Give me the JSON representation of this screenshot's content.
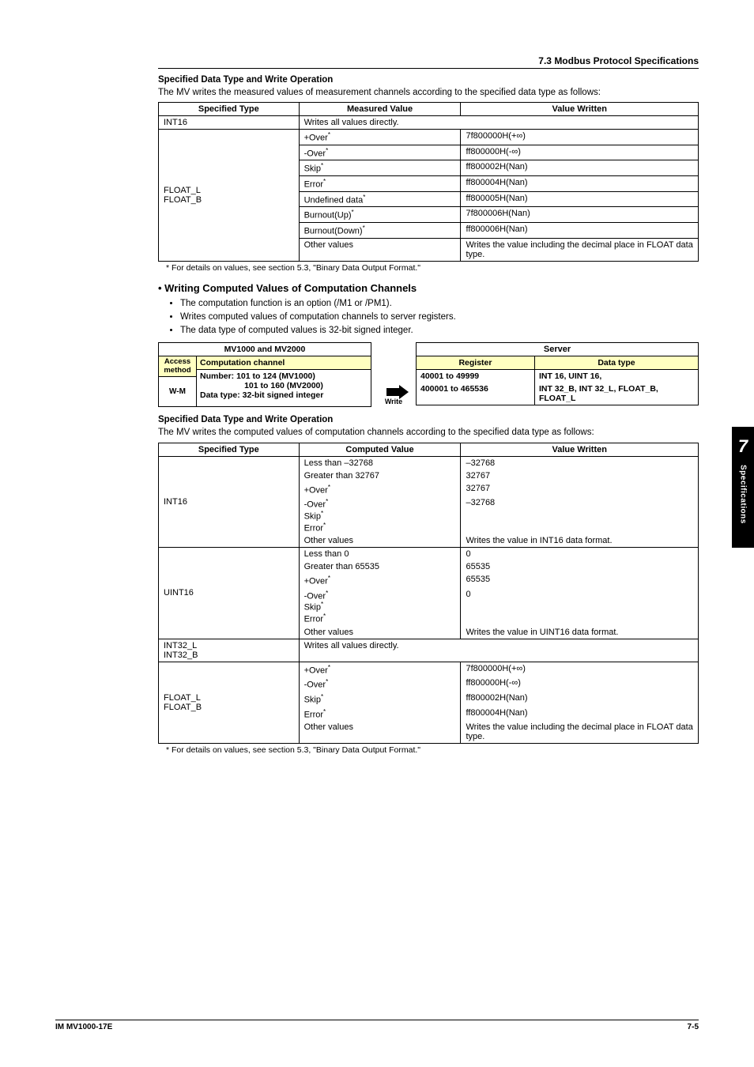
{
  "header": {
    "section": "7.3  Modbus Protocol Specifications"
  },
  "block1": {
    "heading": "Specified Data Type and Write Operation",
    "intro": "The MV writes the measured values of measurement channels according to the specified data type as follows:",
    "table": {
      "headers": [
        "Specified Type",
        "Measured Value",
        "Value Written"
      ],
      "row_int16": {
        "type": "INT16",
        "span": "Writes all values directly."
      },
      "group_label": "FLOAT_L\nFLOAT_B",
      "rows": [
        {
          "mv": "+Over",
          "sup": "*",
          "vw": "7f800000H(+∞)"
        },
        {
          "mv": "-Over",
          "sup": "*",
          "vw": "ff800000H(-∞)"
        },
        {
          "mv": "Skip",
          "sup": "*",
          "vw": "ff800002H(Nan)"
        },
        {
          "mv": "Error",
          "sup": "*",
          "vw": "ff800004H(Nan)"
        },
        {
          "mv": "Undefined data",
          "sup": "*",
          "vw": "ff800005H(Nan)"
        },
        {
          "mv": "Burnout(Up)",
          "sup": "*",
          "vw": "7f800006H(Nan)"
        },
        {
          "mv": "Burnout(Down)",
          "sup": "*",
          "vw": "ff800006H(Nan)"
        },
        {
          "mv": "Other values",
          "sup": "",
          "vw": "Writes the value including the decimal place in FLOAT data type."
        }
      ]
    },
    "footnote": "*    For details on values, see section 5.3, \"Binary Data Output Format.\""
  },
  "block2": {
    "heading": "•   Writing Computed Values of Computation Channels",
    "bullets": [
      "The computation function is an option (/M1 or /PM1).",
      "Writes computed values of computation channels to server registers.",
      "The data type of computed values is 32-bit signed integer."
    ],
    "diagram": {
      "left_title": "MV1000 and MV2000",
      "access_top": "Access method",
      "access_bottom": "W-M",
      "chan_top": "Computation channel",
      "chan_bottom_l1": "Number: 101 to 124 (MV1000)",
      "chan_bottom_l2": "101 to 160 (MV2000)",
      "chan_bottom_l3": "Data type: 32-bit signed integer",
      "arrow_label": "Write",
      "server_title": "Server",
      "reg_header": "Register",
      "dt_header": "Data type",
      "rows": [
        {
          "reg": "40001 to 49999",
          "dt": "INT 16, UINT 16,"
        },
        {
          "reg": "400001 to 465536",
          "dt": "INT 32_B, INT 32_L, FLOAT_B, FLOAT_L"
        }
      ]
    }
  },
  "block3": {
    "heading": "Specified Data Type and Write Operation",
    "intro": "The MV writes the computed values of computation channels according to the specified data type as follows:",
    "table": {
      "headers": [
        "Specified Type",
        "Computed Value",
        "Value Written"
      ],
      "groups": [
        {
          "type": "INT16",
          "rows": [
            {
              "cv": "Less than –32768",
              "sup": "",
              "vw": "–32768"
            },
            {
              "cv": "Greater than 32767",
              "sup": "",
              "vw": "32767"
            },
            {
              "cv": "+Over",
              "sup": "*",
              "vw": "32767"
            },
            {
              "cv": "-Over",
              "sup": "*",
              "vw": "–32768"
            },
            {
              "cv": "Skip",
              "sup": "*",
              "vw": ""
            },
            {
              "cv": "Error",
              "sup": "*",
              "vw": ""
            },
            {
              "cv": "Other values",
              "sup": "",
              "vw": "Writes the value in INT16 data format."
            }
          ]
        },
        {
          "type": "UINT16",
          "rows": [
            {
              "cv": "Less than 0",
              "sup": "",
              "vw": "0"
            },
            {
              "cv": "Greater than 65535",
              "sup": "",
              "vw": "65535"
            },
            {
              "cv": "+Over",
              "sup": "*",
              "vw": "65535"
            },
            {
              "cv": "-Over",
              "sup": "*",
              "vw": "0"
            },
            {
              "cv": "Skip",
              "sup": "*",
              "vw": ""
            },
            {
              "cv": "Error",
              "sup": "*",
              "vw": ""
            },
            {
              "cv": "Other values",
              "sup": "",
              "vw": "Writes the value in UINT16 data format."
            }
          ]
        },
        {
          "type": "INT32_L\nINT32_B",
          "rows": [
            {
              "cv_span": "Writes all values directly."
            }
          ]
        },
        {
          "type": "FLOAT_L\nFLOAT_B",
          "rows": [
            {
              "cv": "+Over",
              "sup": "*",
              "vw": "7f800000H(+∞)"
            },
            {
              "cv": "-Over",
              "sup": "*",
              "vw": "ff800000H(-∞)"
            },
            {
              "cv": "Skip",
              "sup": "*",
              "vw": "ff800002H(Nan)"
            },
            {
              "cv": "Error",
              "sup": "*",
              "vw": "ff800004H(Nan)"
            },
            {
              "cv": "Other values",
              "sup": "",
              "vw": "Writes the value including the decimal place in FLOAT data type."
            }
          ]
        }
      ]
    },
    "footnote": "*    For details on values, see section 5.3, \"Binary Data Output Format.\""
  },
  "sidetab": {
    "num": "7",
    "text": "Specifications"
  },
  "footer": {
    "left": "IM MV1000-17E",
    "right": "7-5"
  }
}
